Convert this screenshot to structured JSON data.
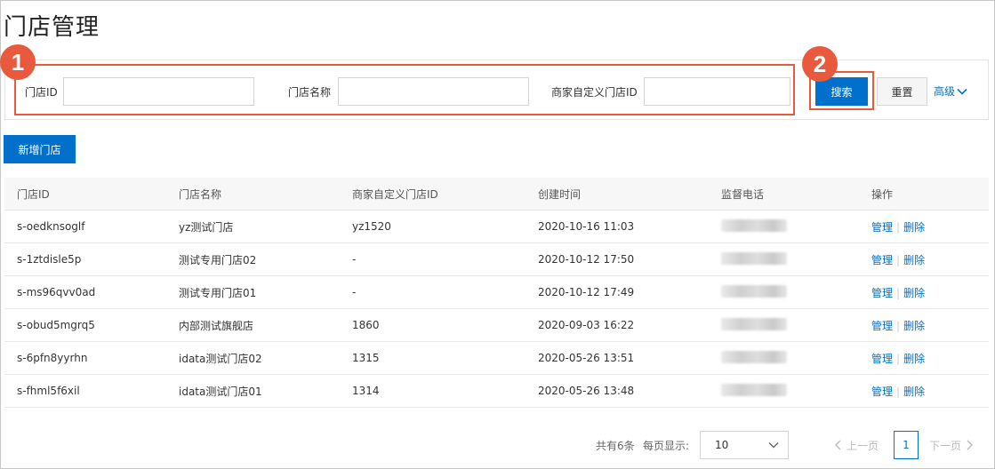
{
  "page": {
    "title": "门店管理"
  },
  "markers": {
    "one": "1",
    "two": "2"
  },
  "filters": {
    "store_id_label": "门店ID",
    "store_id_value": "",
    "store_name_label": "门店名称",
    "store_name_value": "",
    "custom_id_label": "商家自定义门店ID",
    "custom_id_value": ""
  },
  "actions": {
    "search_label": "搜索",
    "reset_label": "重置",
    "advanced_label": "高级",
    "add_store_label": "新增门店"
  },
  "table": {
    "columns": [
      "门店ID",
      "门店名称",
      "商家自定义门店ID",
      "创建时间",
      "监督电话",
      "操作"
    ],
    "rows": [
      {
        "id": "s-oedknsoglf",
        "name": "yz测试门店",
        "custom_id": "yz1520",
        "created": "2020-10-16 11:03"
      },
      {
        "id": "s-1ztdisle5p",
        "name": "测试专用门店02",
        "custom_id": "-",
        "created": "2020-10-12 17:50"
      },
      {
        "id": "s-ms96qvv0ad",
        "name": "测试专用门店01",
        "custom_id": "-",
        "created": "2020-10-12 17:49"
      },
      {
        "id": "s-obud5mgrq5",
        "name": "内部测试旗舰店",
        "custom_id": "1860",
        "created": "2020-09-03 16:22"
      },
      {
        "id": "s-6pfn8yyrhn",
        "name": "idata测试门店02",
        "custom_id": "1315",
        "created": "2020-05-26 13:51"
      },
      {
        "id": "s-fhml5f6xil",
        "name": "idata测试门店01",
        "custom_id": "1314",
        "created": "2020-05-26 13:48"
      }
    ],
    "row_action_manage": "管理",
    "row_action_delete": "删除",
    "row_action_separator": "|"
  },
  "pagination": {
    "total_text": "共有6条",
    "page_size_label": "每页显示:",
    "page_size_value": "10",
    "prev_label": "上一页",
    "current_page": "1",
    "next_label": "下一页"
  },
  "colors": {
    "accent": "#0070cc",
    "highlight": "#e8593e"
  },
  "icons": [
    "chevron-down-icon",
    "chevron-left-icon",
    "chevron-right-icon"
  ]
}
